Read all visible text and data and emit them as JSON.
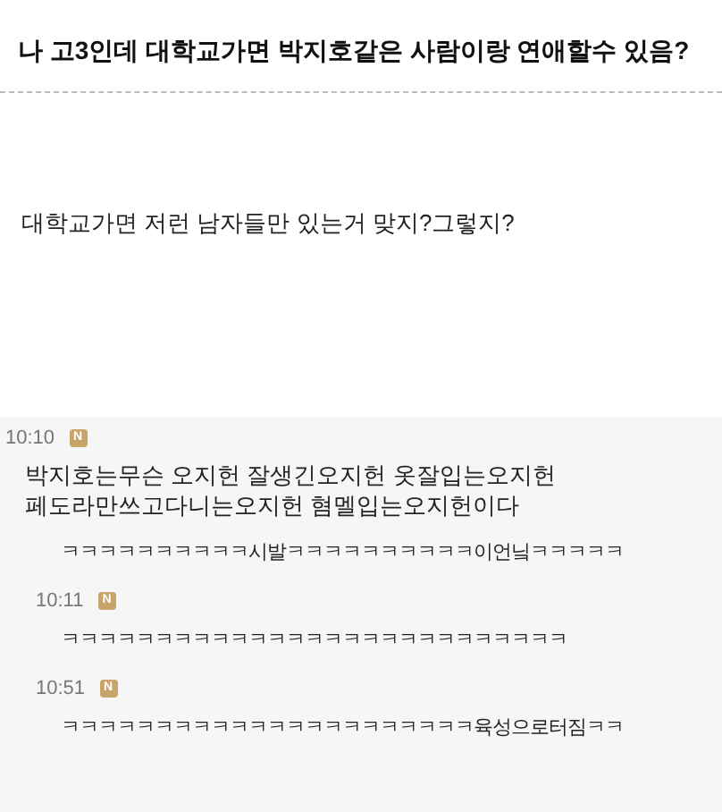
{
  "post": {
    "title": "나 고3인데 대학교가면 박지호같은 사람이랑 연애할수 있음?",
    "body": "대학교가면 저런 남자들만 있는거 맞지?그렇지?"
  },
  "comments": [
    {
      "time": "10:10",
      "badge": "N",
      "lines": [
        "박지호는무슨 오지헌 잘생긴오지헌 옷잘입는오지헌",
        "페도라만쓰고다니는오지헌 혐멜입는오지헌이다"
      ],
      "replies": [
        {
          "text": "ㅋㅋㅋㅋㅋㅋㅋㅋㅋㅋ시발ㅋㅋㅋㅋㅋㅋㅋㅋㅋㅋ이언닠ㅋㅋㅋㅋㅋ"
        },
        {
          "time": "10:11",
          "badge": "N",
          "text": "ㅋㅋㅋㅋㅋㅋㅋㅋㅋㅋㅋㅋㅋㅋㅋㅋㅋㅋㅋㅋㅋㅋㅋㅋㅋㅋㅋ"
        },
        {
          "time": "10:51",
          "badge": "N",
          "text": "ㅋㅋㅋㅋㅋㅋㅋㅋㅋㅋㅋㅋㅋㅋㅋㅋㅋㅋㅋㅋㅋㅋ육성으로터짐ㅋㅋ"
        }
      ]
    }
  ]
}
